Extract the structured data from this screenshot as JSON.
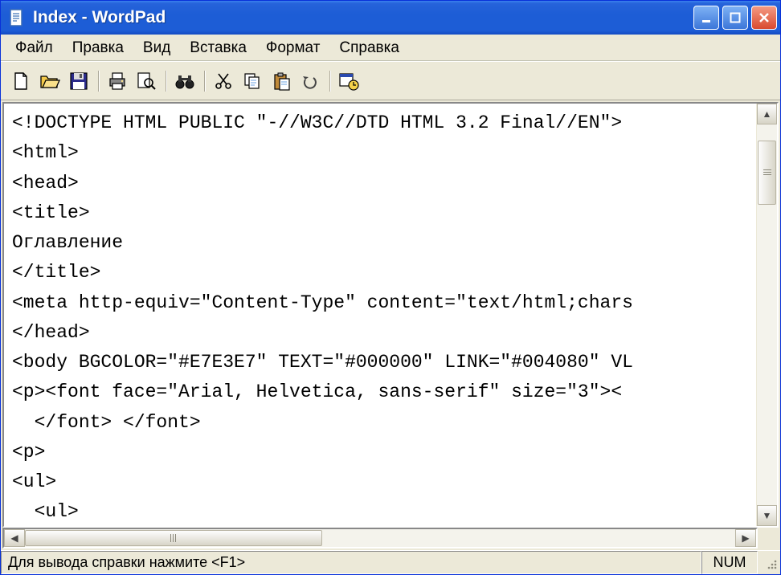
{
  "window": {
    "title": "Index - WordPad"
  },
  "menu": {
    "file": "Файл",
    "edit": "Правка",
    "view": "Вид",
    "insert": "Вставка",
    "format": "Формат",
    "help": "Справка"
  },
  "toolbar_icons": {
    "new": "new-icon",
    "open": "open-icon",
    "save": "save-icon",
    "print": "print-icon",
    "preview": "preview-icon",
    "find": "find-icon",
    "cut": "cut-icon",
    "copy": "copy-icon",
    "paste": "paste-icon",
    "undo": "undo-icon",
    "datetime": "datetime-icon"
  },
  "document": {
    "lines": [
      "<!DOCTYPE HTML PUBLIC \"-//W3C//DTD HTML 3.2 Final//EN\">",
      "<html>",
      "<head>",
      "<title>",
      "Оглавление",
      "</title>",
      "<meta http-equiv=\"Content-Type\" content=\"text/html;chars",
      "</head>",
      "<body BGCOLOR=\"#E7E3E7\" TEXT=\"#000000\" LINK=\"#004080\" VL",
      "<p><font face=\"Arial, Helvetica, sans-serif\" size=\"3\"><",
      "  </font> </font>",
      "<p>",
      "<ul>",
      "  <ul>"
    ]
  },
  "status": {
    "help": "Для вывода справки нажмите <F1>",
    "num": "NUM"
  }
}
